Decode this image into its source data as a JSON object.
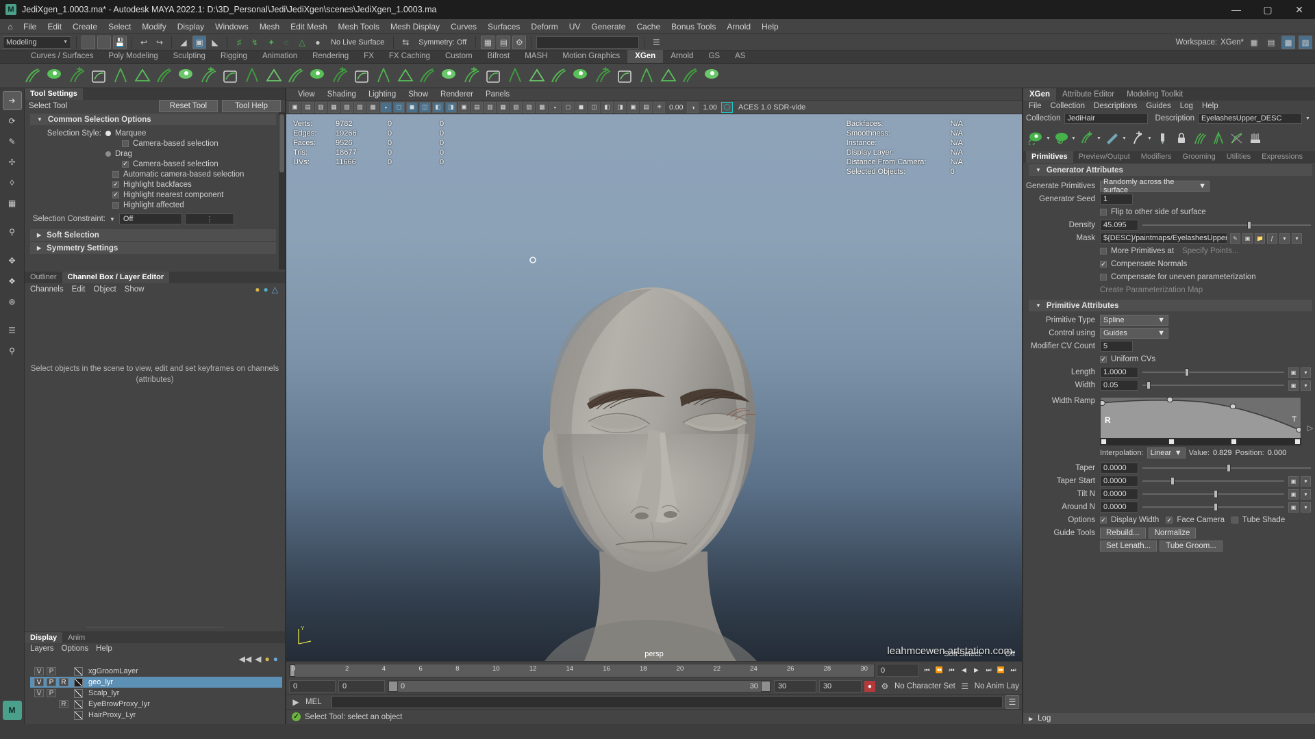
{
  "titlebar": {
    "title": "JediXgen_1.0003.ma* - Autodesk MAYA 2022.1: D:\\3D_Personal\\Jedi\\JediXgen\\scenes\\JediXgen_1.0003.ma",
    "logo": "M",
    "minimize": "—",
    "maximize": "▢",
    "close": "✕"
  },
  "menubar": {
    "home_icon": "home-icon",
    "items": [
      "File",
      "Edit",
      "Create",
      "Select",
      "Modify",
      "Display",
      "Windows",
      "Mesh",
      "Edit Mesh",
      "Mesh Tools",
      "Mesh Display",
      "Curves",
      "Surfaces",
      "Deform",
      "UV",
      "Generate",
      "Cache",
      "Bonus Tools",
      "Arnold",
      "Help"
    ]
  },
  "statusline": {
    "menuset": "Modeling",
    "live_surface": "No Live Surface",
    "symmetry": "Symmetry: Off",
    "workspace_label": "Workspace:",
    "workspace_value": "XGen*"
  },
  "shelf": {
    "tabs": [
      "Curves / Surfaces",
      "Poly Modeling",
      "Sculpting",
      "Rigging",
      "Animation",
      "Rendering",
      "FX",
      "FX Caching",
      "Custom",
      "Bifrost",
      "MASH",
      "Motion Graphics",
      "XGen",
      "Arnold",
      "GS",
      "AS"
    ],
    "active_tab": "XGen"
  },
  "toolbox": {
    "tools": [
      "select-tool",
      "lasso-select-tool",
      "paint-select-tool",
      "move-tool",
      "rotate-tool",
      "scale-tool",
      "soft-modification-tool",
      "show-manipulator-tool",
      "last-tool-used",
      "outliner-panel",
      "persp-view-panel",
      "four-view-panel",
      "hypershade-panel"
    ]
  },
  "tool_settings": {
    "tab": "Tool Settings",
    "tool_name": "Select Tool",
    "reset_button": "Reset Tool",
    "help_button": "Tool Help",
    "frame_common": "Common Selection Options",
    "selection_style_label": "Selection Style:",
    "option_marquee": "Marquee",
    "option_marquee_camera": "Camera-based selection",
    "option_drag": "Drag",
    "option_drag_camera": "Camera-based selection",
    "option_auto_camera": "Automatic camera-based selection",
    "option_highlight_backfaces": "Highlight backfaces",
    "option_highlight_nearest": "Highlight nearest component",
    "option_highlight_affected": "Highlight affected",
    "selection_constraint_label": "Selection Constraint:",
    "selection_constraint_value": "Off",
    "frame_soft": "Soft Selection",
    "frame_symmetry": "Symmetry Settings"
  },
  "channelbox": {
    "tabs": [
      "Outliner",
      "Channel Box / Layer Editor"
    ],
    "active_tab": "Channel Box / Layer Editor",
    "menu": [
      "Channels",
      "Edit",
      "Object",
      "Show"
    ],
    "hint_line1": "Select objects in the scene to view, edit and set keyframes on channels",
    "hint_line2": "(attributes)"
  },
  "layer_editor": {
    "tabs": [
      "Display",
      "Anim"
    ],
    "active_tab": "Display",
    "menu": [
      "Layers",
      "Options",
      "Help"
    ],
    "col_v": "V",
    "col_p": "P",
    "layers": [
      {
        "v": "V",
        "p": "P",
        "r": "",
        "name": "xgGroomLayer",
        "selected": false
      },
      {
        "v": "V",
        "p": "P",
        "r": "R",
        "name": "geo_lyr",
        "selected": true
      },
      {
        "v": "V",
        "p": "P",
        "r": "",
        "name": "Scalp_lyr",
        "selected": false
      },
      {
        "v": "",
        "p": "",
        "r": "R",
        "name": "EyeBrowProxy_lyr",
        "selected": false
      },
      {
        "v": "",
        "p": "",
        "r": "",
        "name": "HairProxy_Lyr",
        "selected": false
      }
    ]
  },
  "viewport": {
    "menu": [
      "View",
      "Shading",
      "Lighting",
      "Show",
      "Renderer",
      "Panels"
    ],
    "exposure": "0.00",
    "gamma": "1.00",
    "color_space": "ACES 1.0 SDR-vide",
    "hud_left": [
      {
        "key": "Verts:",
        "v1": "9782",
        "v2": "0",
        "v3": "0"
      },
      {
        "key": "Edges:",
        "v1": "19266",
        "v2": "0",
        "v3": "0"
      },
      {
        "key": "Faces:",
        "v1": "9526",
        "v2": "0",
        "v3": "0"
      },
      {
        "key": "Tris:",
        "v1": "18677",
        "v2": "0",
        "v3": "0"
      },
      {
        "key": "UVs:",
        "v1": "11666",
        "v2": "0",
        "v3": "0"
      }
    ],
    "hud_right": [
      {
        "key": "Backfaces:",
        "value": "N/A"
      },
      {
        "key": "Smoothness:",
        "value": "N/A"
      },
      {
        "key": "Instance:",
        "value": "N/A"
      },
      {
        "key": "Display Layer:",
        "value": "N/A"
      },
      {
        "key": "Distance From Camera:",
        "value": "N/A"
      },
      {
        "key": "Selected Objects:",
        "value": "0"
      }
    ],
    "camera_label": "persp",
    "soft_select_label": "Soft Select:",
    "soft_select_value": "Off",
    "axis_label": "Y"
  },
  "timeline": {
    "ticks": [
      "2",
      "4",
      "6",
      "8",
      "10",
      "12",
      "14",
      "16",
      "18",
      "20",
      "22",
      "24",
      "26",
      "28",
      "30"
    ],
    "start_label": "0",
    "current_frame": "0",
    "range_start": "0",
    "range_mid_start": "0",
    "range_mid_end": "30",
    "range_end": "30",
    "range_end2": "30",
    "character_set": "No Character Set",
    "anim_layer": "No Anim Lay"
  },
  "mel": {
    "label": "MEL",
    "command": ""
  },
  "statusbar": {
    "help_text": "Select Tool: select an object"
  },
  "xgen": {
    "tabs": [
      "XGen",
      "Attribute Editor",
      "Modeling Toolkit"
    ],
    "active_tab": "XGen",
    "menu": [
      "File",
      "Collection",
      "Descriptions",
      "Guides",
      "Log",
      "Help"
    ],
    "collection_label": "Collection",
    "collection_value": "JediHair",
    "description_label": "Description",
    "description_value": "EyelashesUpper_DESC",
    "toolbar_icons": [
      "preview-eye-icon",
      "generate-primitives-icon",
      "add-guides-icon",
      "brush-icon",
      "sculpt-icon",
      "mask-icon",
      "lock-icon",
      "comb-icon",
      "clump-icon",
      "cut-icon"
    ],
    "subtabs": [
      "Primitives",
      "Preview/Output",
      "Modifiers",
      "Grooming",
      "Utilities",
      "Expressions"
    ],
    "active_subtab": "Primitives",
    "generator_section": "Generator Attributes",
    "generate_primitives_label": "Generate Primitives",
    "generate_primitives_value": "Randomly across the surface",
    "generator_seed_label": "Generator Seed",
    "generator_seed_value": "1",
    "flip_label": "Flip to other side of surface",
    "density_label": "Density",
    "density_value": "45.095",
    "mask_label": "Mask",
    "mask_value": "${DESC}/paintmaps/EyelashesUpperDensity_mask",
    "more_primitives_label": "More Primitives at",
    "specify_points_label": "Specify Points...",
    "compensate_normals_label": "Compensate Normals",
    "compensate_uneven_label": "Compensate for uneven parameterization",
    "create_param_map_label": "Create Parameterization Map",
    "primitive_section": "Primitive Attributes",
    "primitive_type_label": "Primitive Type",
    "primitive_type_value": "Spline",
    "control_using_label": "Control using",
    "control_using_value": "Guides",
    "modifier_cv_label": "Modifier CV Count",
    "modifier_cv_value": "5",
    "uniform_cvs_label": "Uniform CVs",
    "length_label": "Length",
    "length_value": "1.0000",
    "width_label": "Width",
    "width_value": "0.05",
    "width_ramp_label": "Width Ramp",
    "ramp_r": "R",
    "ramp_t": "T",
    "interpolation_label": "Interpolation:",
    "interpolation_value": "Linear",
    "value_label": "Value:",
    "value_value": "0.829",
    "position_label": "Position:",
    "position_value": "0.000",
    "taper_label": "Taper",
    "taper_value": "0.0000",
    "taper_start_label": "Taper Start",
    "taper_start_value": "0.0000",
    "tilt_n_label": "Tilt N",
    "tilt_n_value": "0.0000",
    "around_n_label": "Around N",
    "around_n_value": "0.0000",
    "options_label": "Options",
    "display_width_label": "Display Width",
    "face_camera_label": "Face Camera",
    "tube_shade_label": "Tube Shade",
    "guide_tools_label": "Guide Tools",
    "rebuild_button": "Rebuild...",
    "normalize_button": "Normalize",
    "set_length_button": "Set Lenath...",
    "tube_groom_button": "Tube Groom...",
    "log_label": "Log"
  },
  "watermark": "leahmcewen.artstation.com",
  "colors": {
    "accent": "#5d90b5",
    "green": "#6db33f",
    "xgen_green": "#4fb24f",
    "title_bg": "#1d1d1d"
  }
}
